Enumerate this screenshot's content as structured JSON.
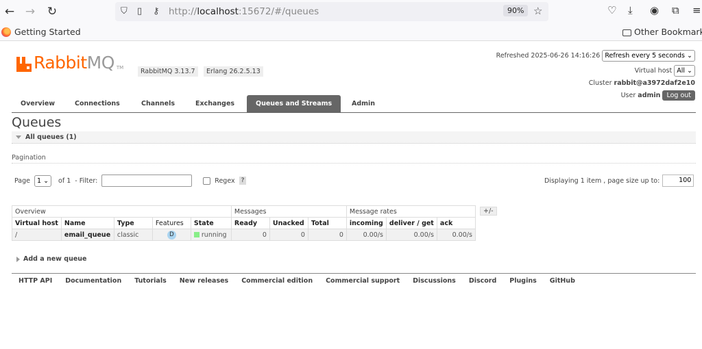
{
  "browser": {
    "url_prefix": "http://",
    "url_host": "localhost",
    "url_rest": ":15672/#/queues",
    "zoom": "90%",
    "bookmark_left": "Getting Started",
    "bookmark_right": "Other Bookmarks"
  },
  "header": {
    "logo_rabbit": "Rabbit",
    "logo_mq": "MQ",
    "logo_tm": "TM",
    "version": "RabbitMQ 3.13.7",
    "erlang": "Erlang 26.2.5.13",
    "refreshed_label": "Refreshed 2025-06-26 14:16:26",
    "refresh_option": "Refresh every 5 seconds",
    "vhost_label": "Virtual host",
    "vhost_value": "All",
    "cluster_label": "Cluster",
    "cluster_value": "rabbit@a3972daf2e10",
    "user_label": "User",
    "user_value": "admin",
    "logout": "Log out"
  },
  "tabs": [
    "Overview",
    "Connections",
    "Channels",
    "Exchanges",
    "Queues and Streams",
    "Admin"
  ],
  "page": {
    "title": "Queues",
    "section": "All queues (1)",
    "pagination_label": "Pagination",
    "page_label": "Page",
    "page_value": "1",
    "of_label": "of 1",
    "filter_label": "- Filter:",
    "filter_value": "",
    "regex_label": "Regex",
    "help": "?",
    "displaying": "Displaying 1 item , page size up to:",
    "page_size": "100"
  },
  "table": {
    "groups": [
      "Overview",
      "Messages",
      "Message rates"
    ],
    "columns": [
      "Virtual host",
      "Name",
      "Type",
      "Features",
      "State",
      "Ready",
      "Unacked",
      "Total",
      "incoming",
      "deliver / get",
      "ack"
    ],
    "rows": [
      {
        "vhost": "/",
        "name": "email_queue",
        "type": "classic",
        "features": "D",
        "state": "running",
        "ready": "0",
        "unacked": "0",
        "total": "0",
        "incoming": "0.00/s",
        "deliver_get": "0.00/s",
        "ack": "0.00/s"
      }
    ],
    "plus_minus": "+/-"
  },
  "add_queue": "Add a new queue",
  "footer": [
    "HTTP API",
    "Documentation",
    "Tutorials",
    "New releases",
    "Commercial edition",
    "Commercial support",
    "Discussions",
    "Discord",
    "Plugins",
    "GitHub"
  ],
  "colors": {
    "brand": "#ff6600",
    "active_tab": "#666666",
    "state_running": "#88ee88"
  }
}
